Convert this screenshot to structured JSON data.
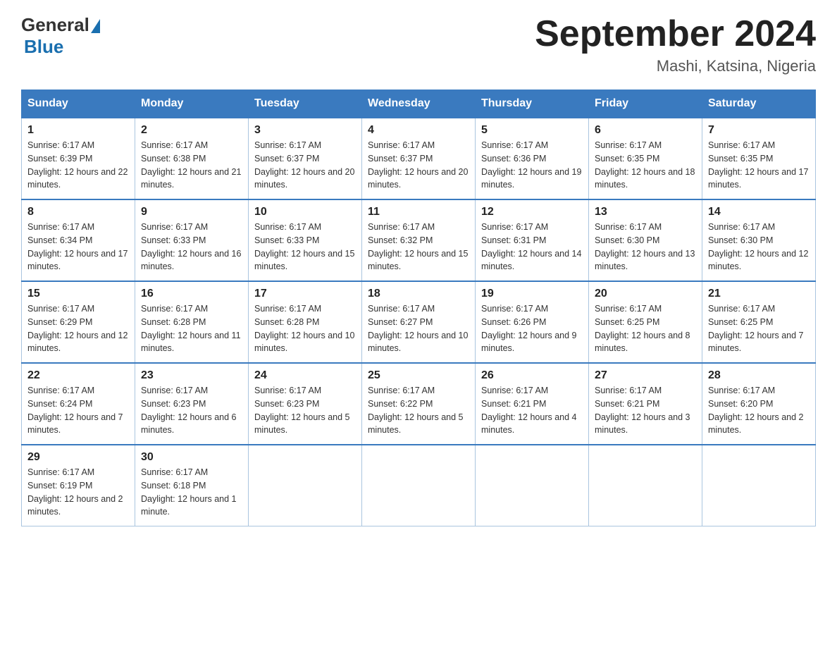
{
  "header": {
    "logo": {
      "text_general": "General",
      "text_blue": "Blue",
      "triangle_symbol": "▲"
    },
    "title": "September 2024",
    "subtitle": "Mashi, Katsina, Nigeria"
  },
  "days_of_week": [
    "Sunday",
    "Monday",
    "Tuesday",
    "Wednesday",
    "Thursday",
    "Friday",
    "Saturday"
  ],
  "weeks": [
    [
      {
        "day": "1",
        "sunrise": "Sunrise: 6:17 AM",
        "sunset": "Sunset: 6:39 PM",
        "daylight": "Daylight: 12 hours and 22 minutes."
      },
      {
        "day": "2",
        "sunrise": "Sunrise: 6:17 AM",
        "sunset": "Sunset: 6:38 PM",
        "daylight": "Daylight: 12 hours and 21 minutes."
      },
      {
        "day": "3",
        "sunrise": "Sunrise: 6:17 AM",
        "sunset": "Sunset: 6:37 PM",
        "daylight": "Daylight: 12 hours and 20 minutes."
      },
      {
        "day": "4",
        "sunrise": "Sunrise: 6:17 AM",
        "sunset": "Sunset: 6:37 PM",
        "daylight": "Daylight: 12 hours and 20 minutes."
      },
      {
        "day": "5",
        "sunrise": "Sunrise: 6:17 AM",
        "sunset": "Sunset: 6:36 PM",
        "daylight": "Daylight: 12 hours and 19 minutes."
      },
      {
        "day": "6",
        "sunrise": "Sunrise: 6:17 AM",
        "sunset": "Sunset: 6:35 PM",
        "daylight": "Daylight: 12 hours and 18 minutes."
      },
      {
        "day": "7",
        "sunrise": "Sunrise: 6:17 AM",
        "sunset": "Sunset: 6:35 PM",
        "daylight": "Daylight: 12 hours and 17 minutes."
      }
    ],
    [
      {
        "day": "8",
        "sunrise": "Sunrise: 6:17 AM",
        "sunset": "Sunset: 6:34 PM",
        "daylight": "Daylight: 12 hours and 17 minutes."
      },
      {
        "day": "9",
        "sunrise": "Sunrise: 6:17 AM",
        "sunset": "Sunset: 6:33 PM",
        "daylight": "Daylight: 12 hours and 16 minutes."
      },
      {
        "day": "10",
        "sunrise": "Sunrise: 6:17 AM",
        "sunset": "Sunset: 6:33 PM",
        "daylight": "Daylight: 12 hours and 15 minutes."
      },
      {
        "day": "11",
        "sunrise": "Sunrise: 6:17 AM",
        "sunset": "Sunset: 6:32 PM",
        "daylight": "Daylight: 12 hours and 15 minutes."
      },
      {
        "day": "12",
        "sunrise": "Sunrise: 6:17 AM",
        "sunset": "Sunset: 6:31 PM",
        "daylight": "Daylight: 12 hours and 14 minutes."
      },
      {
        "day": "13",
        "sunrise": "Sunrise: 6:17 AM",
        "sunset": "Sunset: 6:30 PM",
        "daylight": "Daylight: 12 hours and 13 minutes."
      },
      {
        "day": "14",
        "sunrise": "Sunrise: 6:17 AM",
        "sunset": "Sunset: 6:30 PM",
        "daylight": "Daylight: 12 hours and 12 minutes."
      }
    ],
    [
      {
        "day": "15",
        "sunrise": "Sunrise: 6:17 AM",
        "sunset": "Sunset: 6:29 PM",
        "daylight": "Daylight: 12 hours and 12 minutes."
      },
      {
        "day": "16",
        "sunrise": "Sunrise: 6:17 AM",
        "sunset": "Sunset: 6:28 PM",
        "daylight": "Daylight: 12 hours and 11 minutes."
      },
      {
        "day": "17",
        "sunrise": "Sunrise: 6:17 AM",
        "sunset": "Sunset: 6:28 PM",
        "daylight": "Daylight: 12 hours and 10 minutes."
      },
      {
        "day": "18",
        "sunrise": "Sunrise: 6:17 AM",
        "sunset": "Sunset: 6:27 PM",
        "daylight": "Daylight: 12 hours and 10 minutes."
      },
      {
        "day": "19",
        "sunrise": "Sunrise: 6:17 AM",
        "sunset": "Sunset: 6:26 PM",
        "daylight": "Daylight: 12 hours and 9 minutes."
      },
      {
        "day": "20",
        "sunrise": "Sunrise: 6:17 AM",
        "sunset": "Sunset: 6:25 PM",
        "daylight": "Daylight: 12 hours and 8 minutes."
      },
      {
        "day": "21",
        "sunrise": "Sunrise: 6:17 AM",
        "sunset": "Sunset: 6:25 PM",
        "daylight": "Daylight: 12 hours and 7 minutes."
      }
    ],
    [
      {
        "day": "22",
        "sunrise": "Sunrise: 6:17 AM",
        "sunset": "Sunset: 6:24 PM",
        "daylight": "Daylight: 12 hours and 7 minutes."
      },
      {
        "day": "23",
        "sunrise": "Sunrise: 6:17 AM",
        "sunset": "Sunset: 6:23 PM",
        "daylight": "Daylight: 12 hours and 6 minutes."
      },
      {
        "day": "24",
        "sunrise": "Sunrise: 6:17 AM",
        "sunset": "Sunset: 6:23 PM",
        "daylight": "Daylight: 12 hours and 5 minutes."
      },
      {
        "day": "25",
        "sunrise": "Sunrise: 6:17 AM",
        "sunset": "Sunset: 6:22 PM",
        "daylight": "Daylight: 12 hours and 5 minutes."
      },
      {
        "day": "26",
        "sunrise": "Sunrise: 6:17 AM",
        "sunset": "Sunset: 6:21 PM",
        "daylight": "Daylight: 12 hours and 4 minutes."
      },
      {
        "day": "27",
        "sunrise": "Sunrise: 6:17 AM",
        "sunset": "Sunset: 6:21 PM",
        "daylight": "Daylight: 12 hours and 3 minutes."
      },
      {
        "day": "28",
        "sunrise": "Sunrise: 6:17 AM",
        "sunset": "Sunset: 6:20 PM",
        "daylight": "Daylight: 12 hours and 2 minutes."
      }
    ],
    [
      {
        "day": "29",
        "sunrise": "Sunrise: 6:17 AM",
        "sunset": "Sunset: 6:19 PM",
        "daylight": "Daylight: 12 hours and 2 minutes."
      },
      {
        "day": "30",
        "sunrise": "Sunrise: 6:17 AM",
        "sunset": "Sunset: 6:18 PM",
        "daylight": "Daylight: 12 hours and 1 minute."
      },
      null,
      null,
      null,
      null,
      null
    ]
  ]
}
